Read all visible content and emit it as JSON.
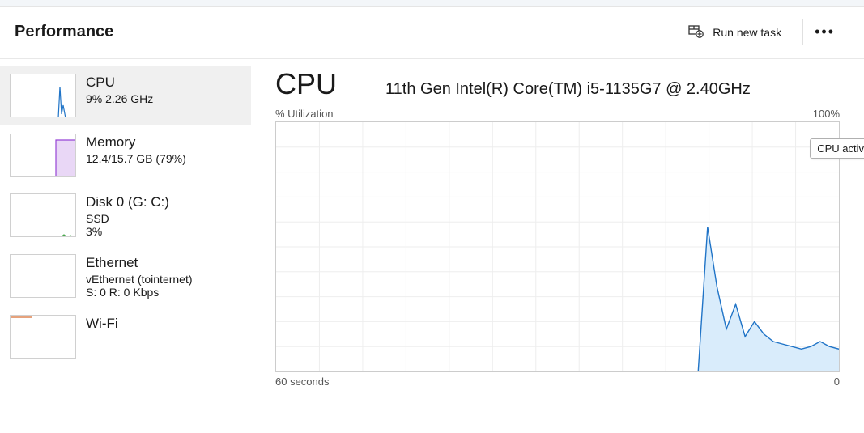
{
  "header": {
    "title": "Performance",
    "run_new_task": "Run new task",
    "overflow": "•••"
  },
  "sidebar": {
    "items": [
      {
        "title": "CPU",
        "sub1": "9%  2.26 GHz",
        "sub2": ""
      },
      {
        "title": "Memory",
        "sub1": "12.4/15.7 GB (79%)",
        "sub2": ""
      },
      {
        "title": "Disk 0 (G: C:)",
        "sub1": "SSD",
        "sub2": "3%"
      },
      {
        "title": "Ethernet",
        "sub1": "vEthernet (tointernet)",
        "sub2": "S: 0  R: 0 Kbps"
      },
      {
        "title": "Wi-Fi",
        "sub1": "",
        "sub2": ""
      }
    ]
  },
  "main": {
    "title": "CPU",
    "model": "11th Gen Intel(R) Core(TM) i5-1135G7 @ 2.40GHz",
    "ylabel": "% Utilization",
    "ymax": "100%",
    "xlabel_left": "60 seconds",
    "xlabel_right": "0",
    "tooltip": "CPU activity"
  },
  "chart_data": {
    "type": "line",
    "title": "% Utilization",
    "xlabel": "seconds",
    "ylabel": "% Utilization",
    "ylim": [
      0,
      100
    ],
    "x": [
      60,
      59,
      58,
      57,
      56,
      55,
      54,
      53,
      52,
      51,
      50,
      49,
      48,
      47,
      46,
      45,
      44,
      43,
      42,
      41,
      40,
      39,
      38,
      37,
      36,
      35,
      34,
      33,
      32,
      31,
      30,
      29,
      28,
      27,
      26,
      25,
      24,
      23,
      22,
      21,
      20,
      19,
      18,
      17,
      16,
      15,
      14,
      13,
      12,
      11,
      10,
      9,
      8,
      7,
      6,
      5,
      4,
      3,
      2,
      1,
      0
    ],
    "values": [
      0,
      0,
      0,
      0,
      0,
      0,
      0,
      0,
      0,
      0,
      0,
      0,
      0,
      0,
      0,
      0,
      0,
      0,
      0,
      0,
      0,
      0,
      0,
      0,
      0,
      0,
      0,
      0,
      0,
      0,
      0,
      0,
      0,
      0,
      0,
      0,
      0,
      0,
      0,
      0,
      0,
      0,
      0,
      0,
      0,
      0,
      58,
      34,
      17,
      27,
      14,
      20,
      15,
      12,
      11,
      10,
      9,
      10,
      12,
      10,
      9
    ],
    "x_grid_count": 13,
    "y_grid_count": 10
  },
  "colors": {
    "cpu_line": "#2074c7",
    "cpu_fill": "#d9ecfb",
    "memory_fill": "#c8a3ea",
    "memory_line": "#9644d6",
    "disk_line": "#4aa84f",
    "wifi_line": "#d86a2d"
  }
}
